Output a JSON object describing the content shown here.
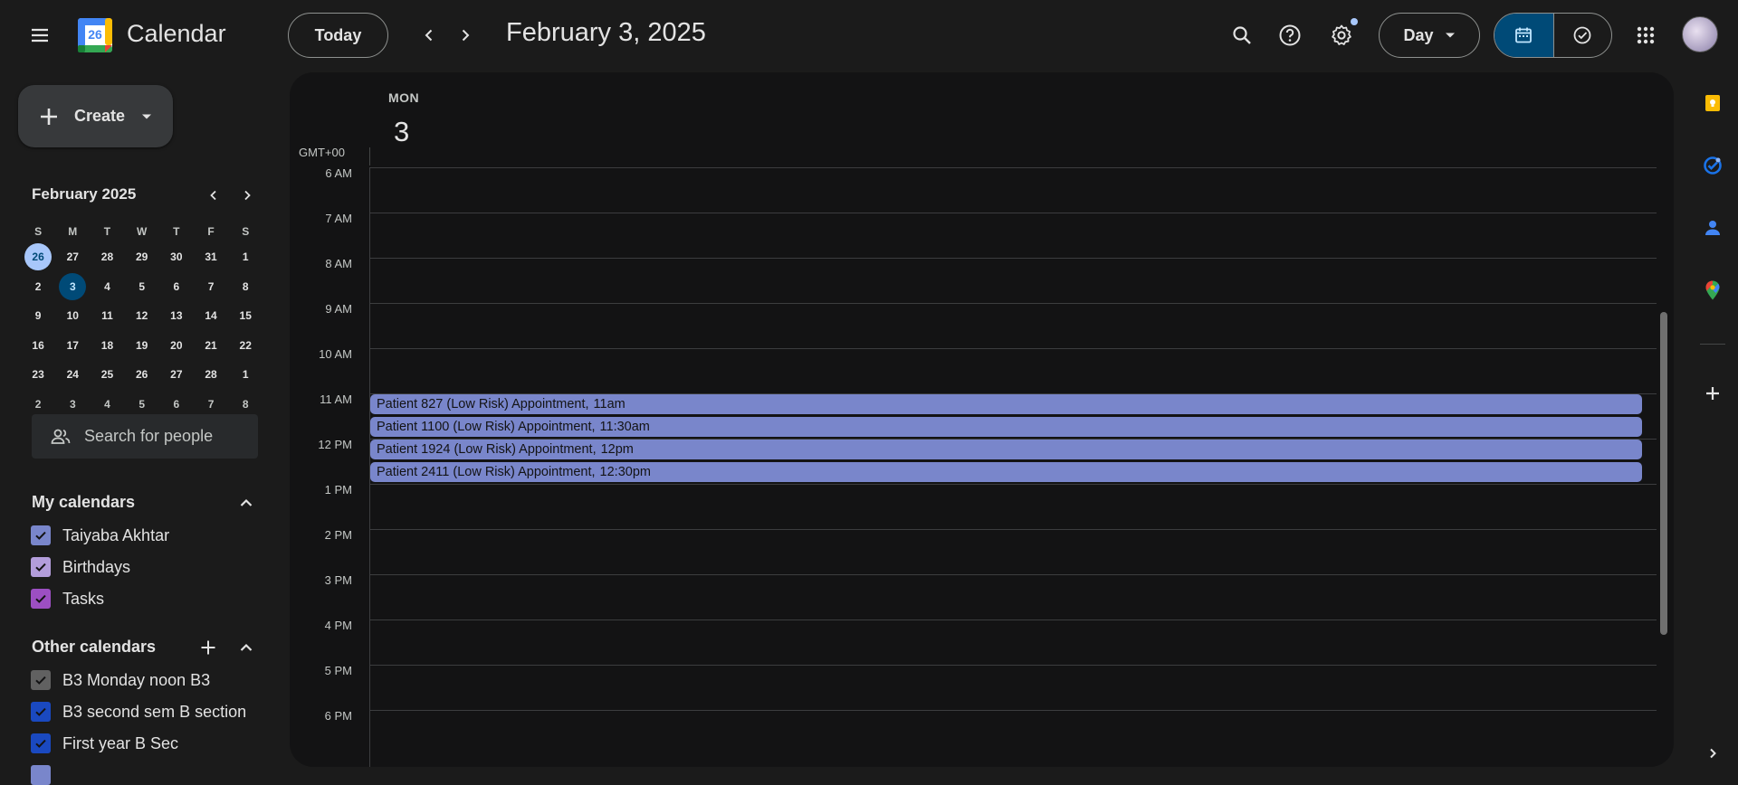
{
  "header": {
    "app_title": "Calendar",
    "logo_day": "26",
    "today_label": "Today",
    "date_title": "February 3, 2025",
    "view_label": "Day"
  },
  "sidebar": {
    "create_label": "Create",
    "mini_calendar": {
      "title": "February 2025",
      "dow": [
        "S",
        "M",
        "T",
        "W",
        "T",
        "F",
        "S"
      ],
      "weeks": [
        [
          "26",
          "27",
          "28",
          "29",
          "30",
          "31",
          "1"
        ],
        [
          "2",
          "3",
          "4",
          "5",
          "6",
          "7",
          "8"
        ],
        [
          "9",
          "10",
          "11",
          "12",
          "13",
          "14",
          "15"
        ],
        [
          "16",
          "17",
          "18",
          "19",
          "20",
          "21",
          "22"
        ],
        [
          "23",
          "24",
          "25",
          "26",
          "27",
          "28",
          "1"
        ],
        [
          "2",
          "3",
          "4",
          "5",
          "6",
          "7",
          "8"
        ]
      ]
    },
    "search_people_placeholder": "Search for people",
    "my_calendars": {
      "title": "My calendars",
      "items": [
        {
          "label": "Taiyaba Akhtar",
          "color": "#7986cb"
        },
        {
          "label": "Birthdays",
          "color": "#b39ddb"
        },
        {
          "label": "Tasks",
          "color": "#9c4fc2"
        }
      ]
    },
    "other_calendars": {
      "title": "Other calendars",
      "items": [
        {
          "label": "B3 Monday noon B3",
          "color": "#616161"
        },
        {
          "label": "B3 second sem B section",
          "color": "#1a49c0"
        },
        {
          "label": "First year B Sec",
          "color": "#1a49c0"
        }
      ]
    }
  },
  "day_view": {
    "dow": "MON",
    "day_number": "3",
    "timezone": "GMT+00",
    "hours": [
      "6 AM",
      "7 AM",
      "8 AM",
      "9 AM",
      "10 AM",
      "11 AM",
      "12 PM",
      "1 PM",
      "2 PM",
      "3 PM",
      "4 PM",
      "5 PM",
      "6 PM"
    ],
    "events": [
      {
        "title": "Patient 827 (Low Risk) Appointment,",
        "time": "11am"
      },
      {
        "title": "Patient 1100 (Low Risk) Appointment,",
        "time": "11:30am"
      },
      {
        "title": "Patient 1924 (Low Risk) Appointment,",
        "time": "12pm"
      },
      {
        "title": "Patient 2411 (Low Risk) Appointment,",
        "time": "12:30pm"
      }
    ],
    "event_color": "#7986cb"
  },
  "side_rail": [
    "keep-icon",
    "tasks-icon",
    "contacts-icon",
    "maps-icon",
    "add-icon"
  ]
}
